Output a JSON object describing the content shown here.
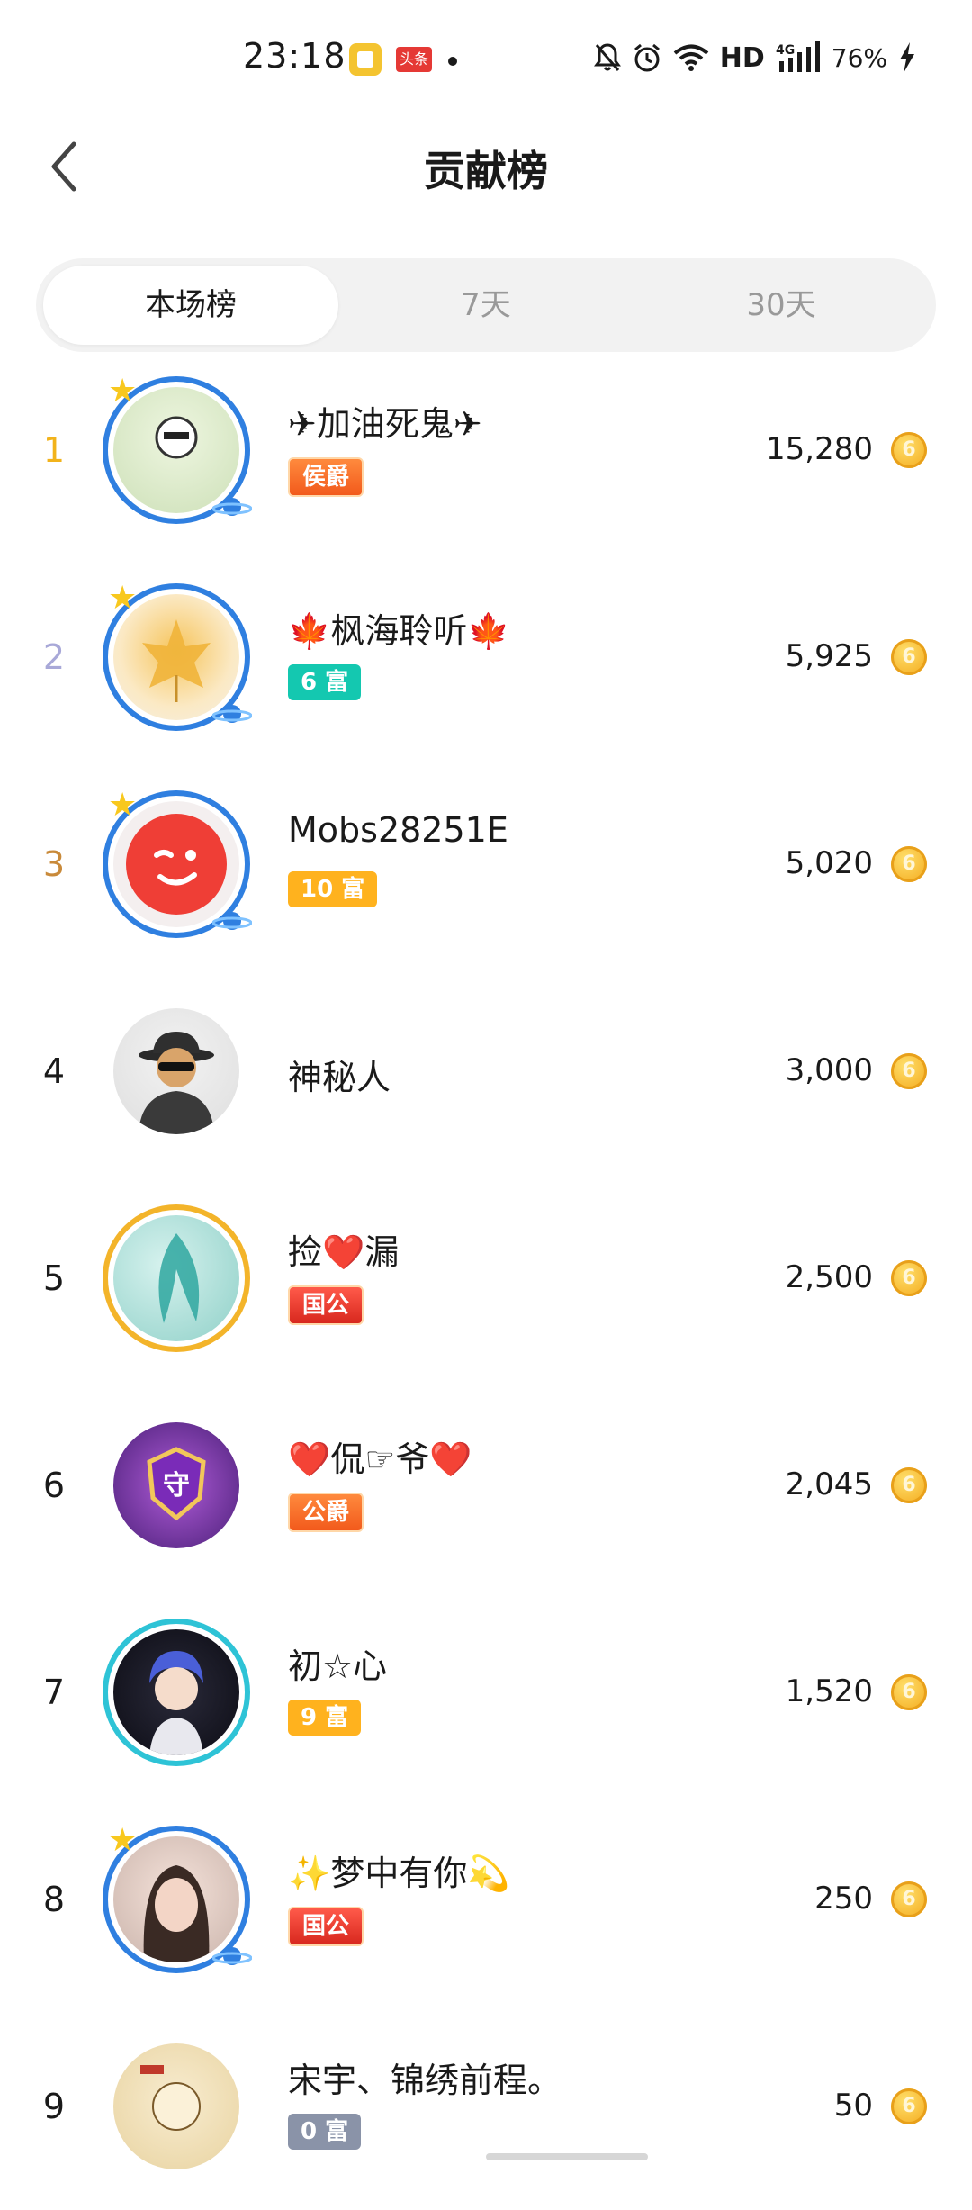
{
  "status_bar": {
    "time": "23:18",
    "app2_label": "头条",
    "hd": "HD",
    "network": "4G",
    "battery": "76%"
  },
  "header": {
    "title": "贡献榜",
    "back_icon": "chevron-left-icon"
  },
  "tabs": [
    {
      "label": "本场榜",
      "active": true
    },
    {
      "label": "7天",
      "active": false
    },
    {
      "label": "30天",
      "active": false
    }
  ],
  "colors": {
    "rank1": "#f2b31b",
    "rank2": "#a8a8d8",
    "rank3": "#c98a3a",
    "rank_default": "#1a1a1a",
    "coin": "#f3a81a"
  },
  "ranking": [
    {
      "rank": "1",
      "name": "✈加油死鬼✈",
      "badge": "侯爵",
      "score": "15,280"
    },
    {
      "rank": "2",
      "name": "🍁枫海聆听🍁",
      "badge": "6 富",
      "score": "5,925"
    },
    {
      "rank": "3",
      "name": "Mobs28251E",
      "badge": "10 富",
      "score": "5,020"
    },
    {
      "rank": "4",
      "name": "神秘人",
      "badge": "",
      "score": "3,000"
    },
    {
      "rank": "5",
      "name": "捡❤️漏",
      "badge": "国公",
      "score": "2,500"
    },
    {
      "rank": "6",
      "name": "❤️侃☞爷❤️",
      "badge": "公爵",
      "score": "2,045"
    },
    {
      "rank": "7",
      "name": "初☆心",
      "badge": "9 富",
      "score": "1,520"
    },
    {
      "rank": "8",
      "name": "✨梦中有你💫",
      "badge": "国公",
      "score": "250"
    },
    {
      "rank": "9",
      "name": "宋宇、锦绣前程。",
      "badge": "0 富",
      "score": "50"
    }
  ]
}
